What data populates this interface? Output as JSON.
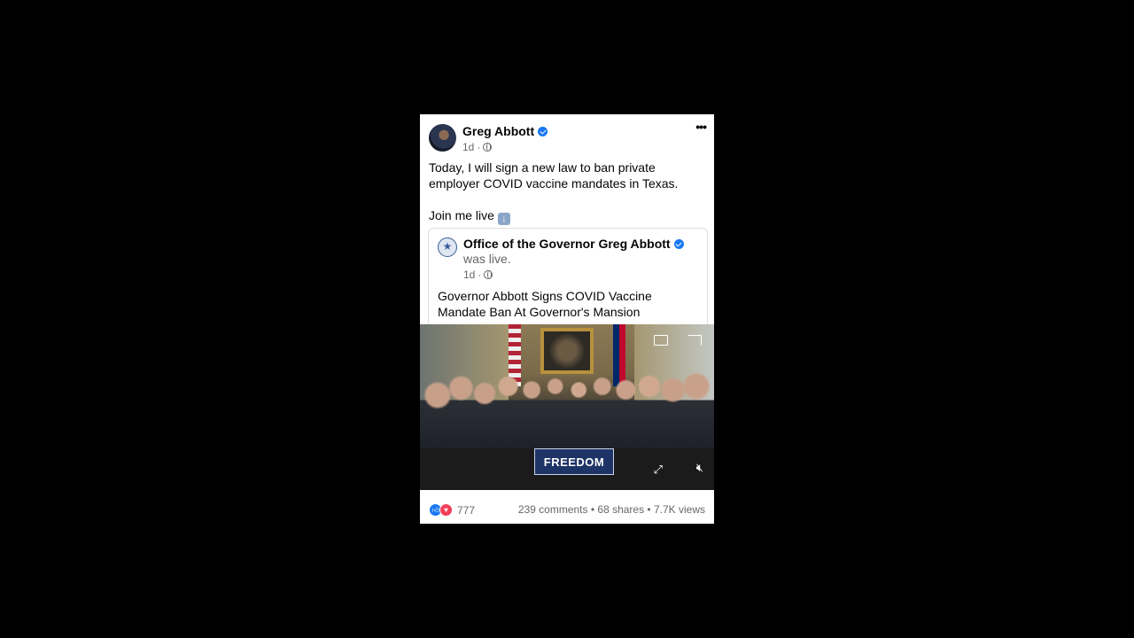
{
  "post": {
    "author": "Greg Abbott",
    "time": "1d",
    "text_line1": "Today, I will sign a new law to ban private employer COVID vaccine mandates in Texas.",
    "text_line2": "Join me live",
    "more_glyph": "•••"
  },
  "shared": {
    "page_name": "Office of the Governor Greg Abbott",
    "status": "was live.",
    "time": "1d",
    "title": "Governor Abbott Signs COVID Vaccine Mandate Ban At Governor's Mansion"
  },
  "video": {
    "sign_text": "FREEDOM"
  },
  "footer": {
    "reaction_count": "777",
    "comments": "239 comments",
    "shares": "68 shares",
    "views": "7.7K views",
    "separator": " • "
  },
  "icons": {
    "verified": "verified-badge-icon",
    "globe": "globe-icon",
    "like": "like-reaction-icon",
    "love": "love-reaction-icon",
    "down_arrow": "down-arrow-emoji-icon"
  },
  "colors": {
    "background": "#000000",
    "card": "#ffffff",
    "accent": "#1877f2",
    "love": "#f33e58",
    "sign": "#1f3466"
  }
}
